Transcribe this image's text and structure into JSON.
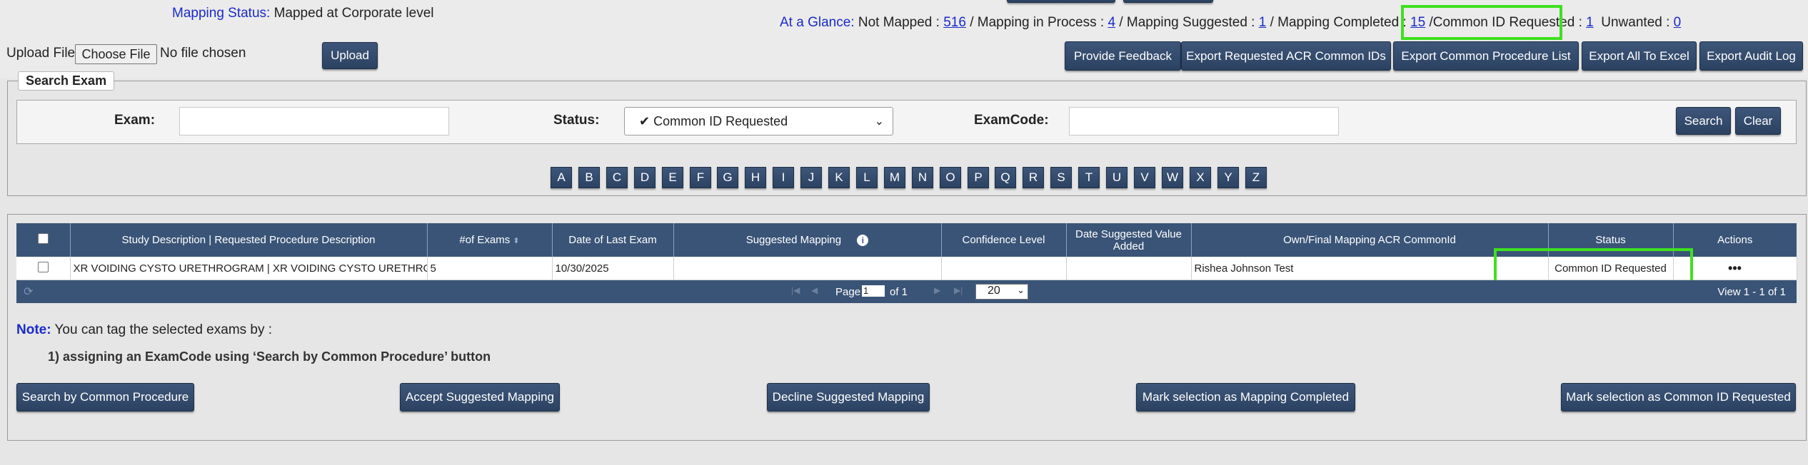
{
  "mapping_status": {
    "label": "Mapping Status:",
    "value": "Mapped at Corporate level"
  },
  "glance": {
    "label": "At a Glance:",
    "not_mapped_label": "Not Mapped :",
    "not_mapped": "516",
    "in_process_label": "/ Mapping in Process :",
    "in_process": "4",
    "suggested_label": "/ Mapping Suggested :",
    "suggested": "1",
    "completed_label": "/ Mapping Completed :",
    "completed": "15",
    "sep": "/",
    "cid_label": "Common ID Requested :",
    "cid": "1",
    "unwanted_label": "Unwanted :",
    "unwanted": "0"
  },
  "upload": {
    "label": "Upload File",
    "choose": "Choose File",
    "nofile": "No file chosen",
    "button": "Upload"
  },
  "toolbar": [
    "Provide Feedback",
    "Export Requested ACR Common IDs",
    "Export Common Procedure List",
    "Export All To Excel",
    "Export Audit Log"
  ],
  "search": {
    "legend": "Search Exam",
    "exam_label": "Exam:",
    "status_label": "Status:",
    "status_value": "✔ Common ID Requested",
    "examcode_label": "ExamCode:",
    "search_btn": "Search",
    "clear_btn": "Clear"
  },
  "letters": [
    "A",
    "B",
    "C",
    "D",
    "E",
    "F",
    "G",
    "H",
    "I",
    "J",
    "K",
    "L",
    "M",
    "N",
    "O",
    "P",
    "Q",
    "R",
    "S",
    "T",
    "U",
    "V",
    "W",
    "X",
    "Y",
    "Z"
  ],
  "table": {
    "headers": [
      "Study Description | Requested Procedure Description",
      "#of Exams",
      "Date of Last Exam",
      "Suggested Mapping",
      "Confidence Level",
      "Date Suggested Value Added",
      "Own/Final Mapping ACR CommonId",
      "Status",
      "Actions"
    ],
    "rows": [
      {
        "desc": "XR VOIDING CYSTO URETHROGRAM | XR VOIDING CYSTO URETHROGRAM",
        "exams": "5",
        "date": "10/30/2025",
        "suggested": "",
        "confidence": "",
        "date_added": "",
        "final": "Rishea Johnson Test",
        "status": "Common ID Requested",
        "actions": "•••"
      }
    ]
  },
  "pager": {
    "page_label": "Page",
    "page_value": "1",
    "of_label": "of 1",
    "page_size": "20",
    "view": "View 1 - 1 of 1"
  },
  "note": {
    "label": "Note:",
    "text": " You can tag the selected exams by :",
    "instruction": "1) assigning an ExamCode using ‘Search by Common Procedure’ button"
  },
  "bottom_buttons": [
    "Search by Common Procedure",
    "Accept Suggested Mapping",
    "Decline Suggested Mapping",
    "Mark selection as Mapping Completed",
    "Mark selection as Common ID Requested"
  ],
  "colors": {
    "accent": "#3a5477",
    "highlight": "#3fe01f",
    "link": "#1a2bc9"
  }
}
